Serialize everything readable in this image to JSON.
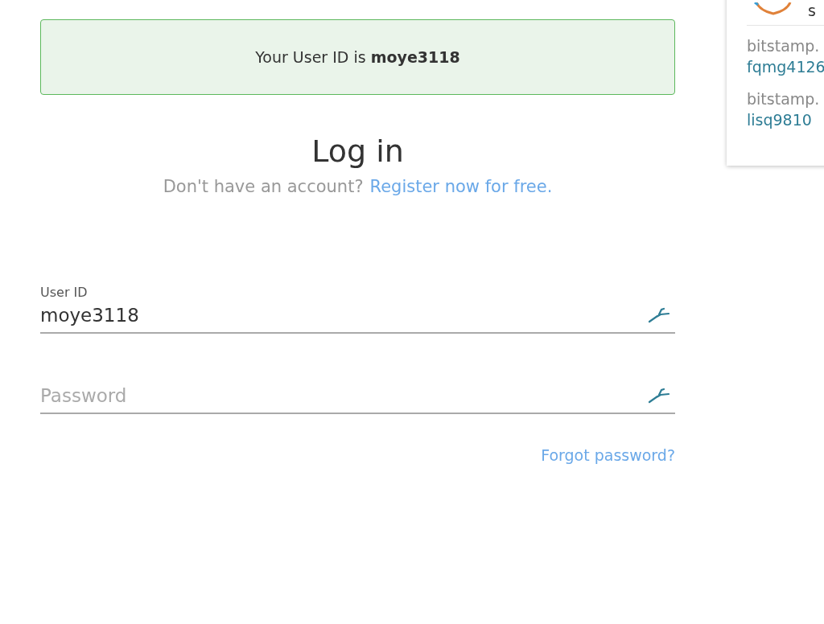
{
  "banner": {
    "text": "Your User ID is **moye3118**"
  },
  "heading": "Log in",
  "register_prompt": {
    "text": "Don't have an account?",
    "link": "Register now for free."
  },
  "fields": [
    {
      "label": "User ID",
      "value": "moye3118"
    },
    {
      "placeholder": "Password"
    }
  ],
  "forgot_link": "Forgot password?",
  "popup": {
    "header_text": "s",
    "accounts": [
      {
        "site": "bitstamp.",
        "user": "fqmg4126"
      },
      {
        "site": "bitstamp.",
        "user": "lisq9810"
      }
    ]
  }
}
